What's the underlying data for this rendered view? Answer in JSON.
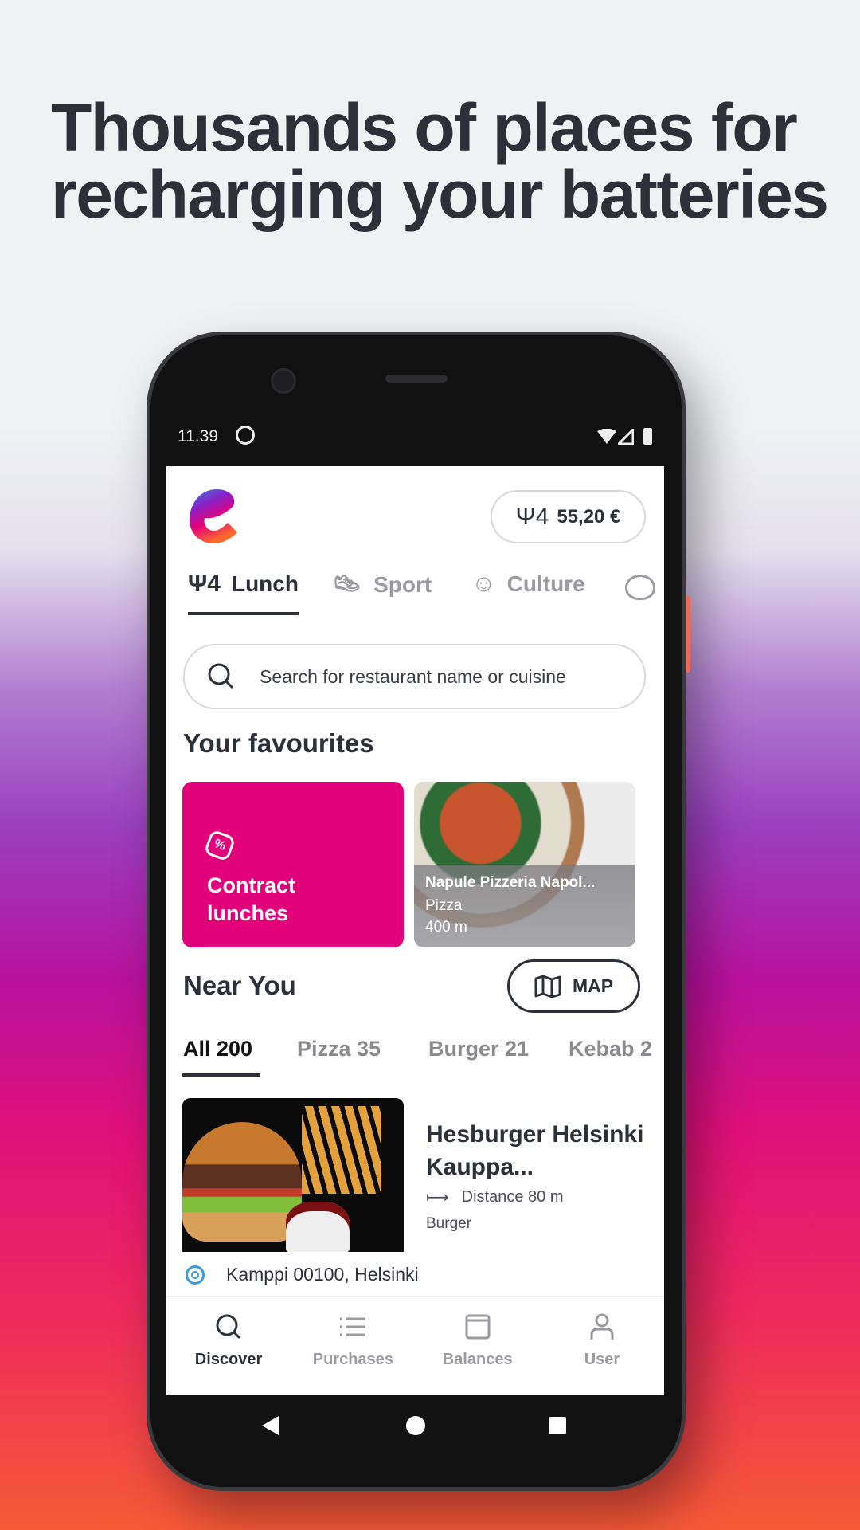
{
  "headline": [
    "Thousands of places for",
    "recharging your batteries"
  ],
  "status_bar": {
    "time": "11.39"
  },
  "header": {
    "balance": "55,20 €"
  },
  "categories": [
    {
      "label": "Lunch",
      "active": true
    },
    {
      "label": "Sport"
    },
    {
      "label": "Culture"
    }
  ],
  "search": {
    "placeholder": "Search for restaurant name or cuisine"
  },
  "favourites": {
    "title": "Your favourites",
    "contract": "Contract lunches",
    "restaurant": {
      "name": "Napule Pizzeria Napol...",
      "cuisine": "Pizza",
      "distance": "400 m"
    }
  },
  "near_you": {
    "title": "Near You",
    "map_label": "MAP",
    "filters": [
      {
        "label": "All 200",
        "active": true
      },
      {
        "label": "Pizza 35"
      },
      {
        "label": "Burger 21"
      },
      {
        "label": "Kebab 2"
      }
    ],
    "listing": {
      "name": "Hesburger Helsinki Kauppa...",
      "distance": "Distance 80 m",
      "cuisine": "Burger",
      "address": "Kamppi 00100, Helsinki"
    }
  },
  "bottom_nav": [
    {
      "label": "Discover",
      "active": true
    },
    {
      "label": "Purchases"
    },
    {
      "label": "Balances"
    },
    {
      "label": "User"
    }
  ],
  "colors": {
    "accent": "#e2007a",
    "text": "#2d3038",
    "location": "#3b9ad9"
  }
}
